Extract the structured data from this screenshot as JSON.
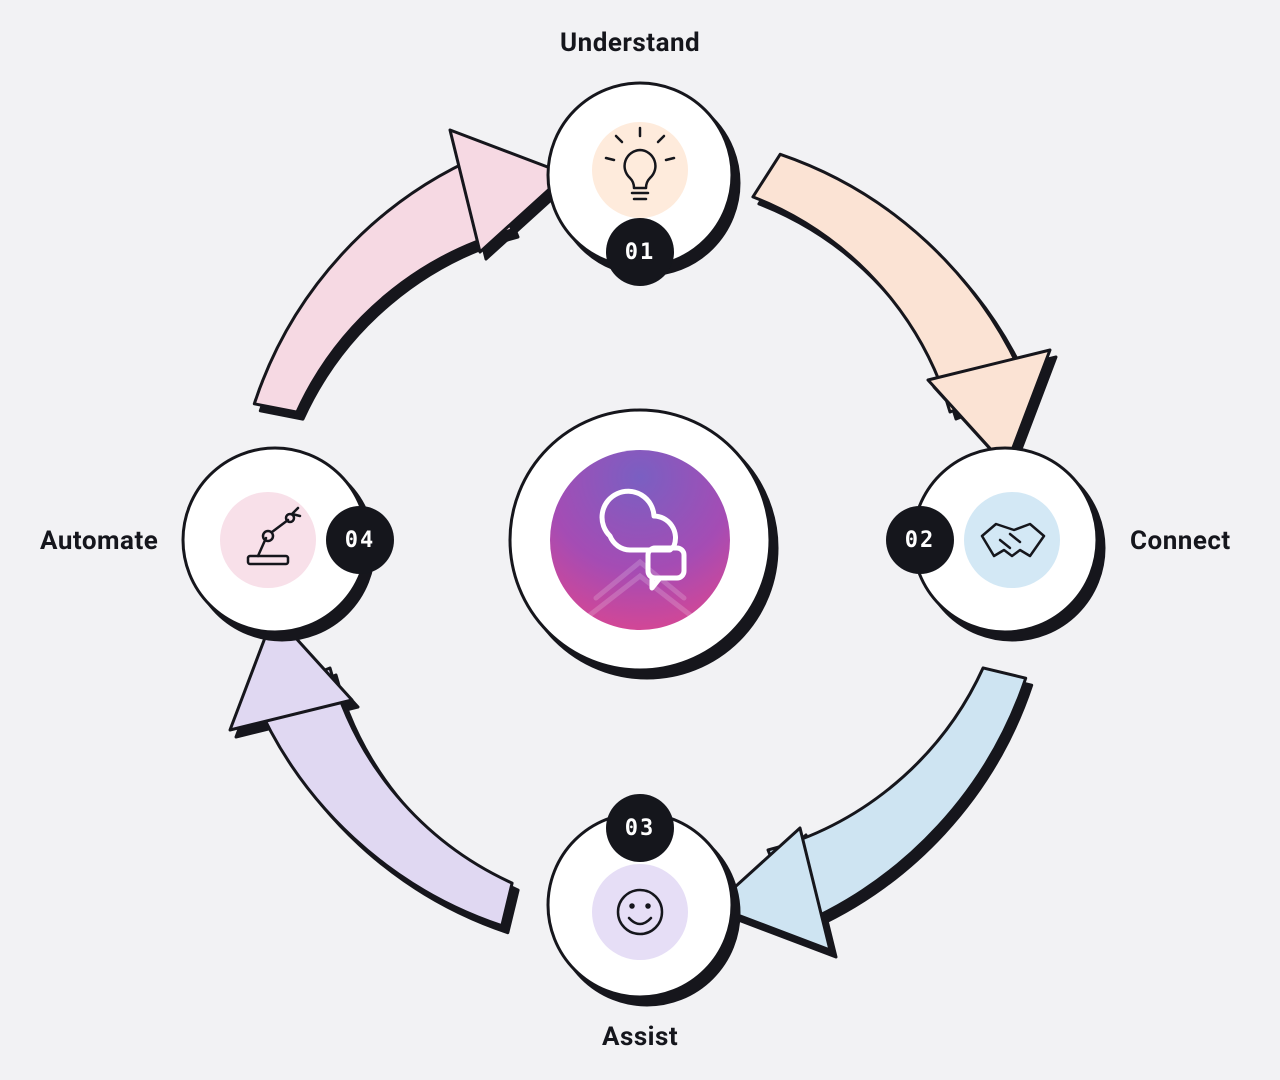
{
  "cycle": {
    "center_icon": "chat-cloud-icon",
    "steps": [
      {
        "num": "01",
        "label": "Understand",
        "icon": "lightbulb-icon",
        "tint": "#FEEBDC",
        "arrow_fill": "#FBE3D4"
      },
      {
        "num": "02",
        "label": "Connect",
        "icon": "handshake-icon",
        "tint": "#D3E8F5",
        "arrow_fill": "#CEE4F2"
      },
      {
        "num": "03",
        "label": "Assist",
        "icon": "smile-icon",
        "tint": "#E6DEF6",
        "arrow_fill": "#E0D8F2"
      },
      {
        "num": "04",
        "label": "Automate",
        "icon": "robot-arm-icon",
        "tint": "#F8E0E9",
        "arrow_fill": "#F6D9E3"
      }
    ]
  }
}
